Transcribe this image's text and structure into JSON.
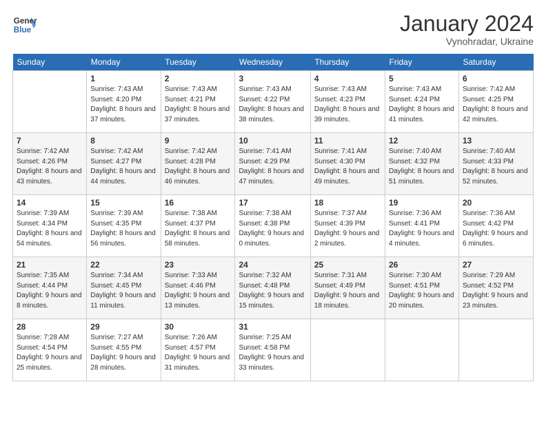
{
  "logo": {
    "line1": "General",
    "line2": "Blue"
  },
  "title": "January 2024",
  "location": "Vynohradar, Ukraine",
  "days_header": [
    "Sunday",
    "Monday",
    "Tuesday",
    "Wednesday",
    "Thursday",
    "Friday",
    "Saturday"
  ],
  "weeks": [
    [
      {
        "num": "",
        "sunrise": "",
        "sunset": "",
        "daylight": ""
      },
      {
        "num": "1",
        "sunrise": "Sunrise: 7:43 AM",
        "sunset": "Sunset: 4:20 PM",
        "daylight": "Daylight: 8 hours and 37 minutes."
      },
      {
        "num": "2",
        "sunrise": "Sunrise: 7:43 AM",
        "sunset": "Sunset: 4:21 PM",
        "daylight": "Daylight: 8 hours and 37 minutes."
      },
      {
        "num": "3",
        "sunrise": "Sunrise: 7:43 AM",
        "sunset": "Sunset: 4:22 PM",
        "daylight": "Daylight: 8 hours and 38 minutes."
      },
      {
        "num": "4",
        "sunrise": "Sunrise: 7:43 AM",
        "sunset": "Sunset: 4:23 PM",
        "daylight": "Daylight: 8 hours and 39 minutes."
      },
      {
        "num": "5",
        "sunrise": "Sunrise: 7:43 AM",
        "sunset": "Sunset: 4:24 PM",
        "daylight": "Daylight: 8 hours and 41 minutes."
      },
      {
        "num": "6",
        "sunrise": "Sunrise: 7:42 AM",
        "sunset": "Sunset: 4:25 PM",
        "daylight": "Daylight: 8 hours and 42 minutes."
      }
    ],
    [
      {
        "num": "7",
        "sunrise": "Sunrise: 7:42 AM",
        "sunset": "Sunset: 4:26 PM",
        "daylight": "Daylight: 8 hours and 43 minutes."
      },
      {
        "num": "8",
        "sunrise": "Sunrise: 7:42 AM",
        "sunset": "Sunset: 4:27 PM",
        "daylight": "Daylight: 8 hours and 44 minutes."
      },
      {
        "num": "9",
        "sunrise": "Sunrise: 7:42 AM",
        "sunset": "Sunset: 4:28 PM",
        "daylight": "Daylight: 8 hours and 46 minutes."
      },
      {
        "num": "10",
        "sunrise": "Sunrise: 7:41 AM",
        "sunset": "Sunset: 4:29 PM",
        "daylight": "Daylight: 8 hours and 47 minutes."
      },
      {
        "num": "11",
        "sunrise": "Sunrise: 7:41 AM",
        "sunset": "Sunset: 4:30 PM",
        "daylight": "Daylight: 8 hours and 49 minutes."
      },
      {
        "num": "12",
        "sunrise": "Sunrise: 7:40 AM",
        "sunset": "Sunset: 4:32 PM",
        "daylight": "Daylight: 8 hours and 51 minutes."
      },
      {
        "num": "13",
        "sunrise": "Sunrise: 7:40 AM",
        "sunset": "Sunset: 4:33 PM",
        "daylight": "Daylight: 8 hours and 52 minutes."
      }
    ],
    [
      {
        "num": "14",
        "sunrise": "Sunrise: 7:39 AM",
        "sunset": "Sunset: 4:34 PM",
        "daylight": "Daylight: 8 hours and 54 minutes."
      },
      {
        "num": "15",
        "sunrise": "Sunrise: 7:39 AM",
        "sunset": "Sunset: 4:35 PM",
        "daylight": "Daylight: 8 hours and 56 minutes."
      },
      {
        "num": "16",
        "sunrise": "Sunrise: 7:38 AM",
        "sunset": "Sunset: 4:37 PM",
        "daylight": "Daylight: 8 hours and 58 minutes."
      },
      {
        "num": "17",
        "sunrise": "Sunrise: 7:38 AM",
        "sunset": "Sunset: 4:38 PM",
        "daylight": "Daylight: 9 hours and 0 minutes."
      },
      {
        "num": "18",
        "sunrise": "Sunrise: 7:37 AM",
        "sunset": "Sunset: 4:39 PM",
        "daylight": "Daylight: 9 hours and 2 minutes."
      },
      {
        "num": "19",
        "sunrise": "Sunrise: 7:36 AM",
        "sunset": "Sunset: 4:41 PM",
        "daylight": "Daylight: 9 hours and 4 minutes."
      },
      {
        "num": "20",
        "sunrise": "Sunrise: 7:36 AM",
        "sunset": "Sunset: 4:42 PM",
        "daylight": "Daylight: 9 hours and 6 minutes."
      }
    ],
    [
      {
        "num": "21",
        "sunrise": "Sunrise: 7:35 AM",
        "sunset": "Sunset: 4:44 PM",
        "daylight": "Daylight: 9 hours and 8 minutes."
      },
      {
        "num": "22",
        "sunrise": "Sunrise: 7:34 AM",
        "sunset": "Sunset: 4:45 PM",
        "daylight": "Daylight: 9 hours and 11 minutes."
      },
      {
        "num": "23",
        "sunrise": "Sunrise: 7:33 AM",
        "sunset": "Sunset: 4:46 PM",
        "daylight": "Daylight: 9 hours and 13 minutes."
      },
      {
        "num": "24",
        "sunrise": "Sunrise: 7:32 AM",
        "sunset": "Sunset: 4:48 PM",
        "daylight": "Daylight: 9 hours and 15 minutes."
      },
      {
        "num": "25",
        "sunrise": "Sunrise: 7:31 AM",
        "sunset": "Sunset: 4:49 PM",
        "daylight": "Daylight: 9 hours and 18 minutes."
      },
      {
        "num": "26",
        "sunrise": "Sunrise: 7:30 AM",
        "sunset": "Sunset: 4:51 PM",
        "daylight": "Daylight: 9 hours and 20 minutes."
      },
      {
        "num": "27",
        "sunrise": "Sunrise: 7:29 AM",
        "sunset": "Sunset: 4:52 PM",
        "daylight": "Daylight: 9 hours and 23 minutes."
      }
    ],
    [
      {
        "num": "28",
        "sunrise": "Sunrise: 7:28 AM",
        "sunset": "Sunset: 4:54 PM",
        "daylight": "Daylight: 9 hours and 25 minutes."
      },
      {
        "num": "29",
        "sunrise": "Sunrise: 7:27 AM",
        "sunset": "Sunset: 4:55 PM",
        "daylight": "Daylight: 9 hours and 28 minutes."
      },
      {
        "num": "30",
        "sunrise": "Sunrise: 7:26 AM",
        "sunset": "Sunset: 4:57 PM",
        "daylight": "Daylight: 9 hours and 31 minutes."
      },
      {
        "num": "31",
        "sunrise": "Sunrise: 7:25 AM",
        "sunset": "Sunset: 4:58 PM",
        "daylight": "Daylight: 9 hours and 33 minutes."
      },
      {
        "num": "",
        "sunrise": "",
        "sunset": "",
        "daylight": ""
      },
      {
        "num": "",
        "sunrise": "",
        "sunset": "",
        "daylight": ""
      },
      {
        "num": "",
        "sunrise": "",
        "sunset": "",
        "daylight": ""
      }
    ]
  ]
}
